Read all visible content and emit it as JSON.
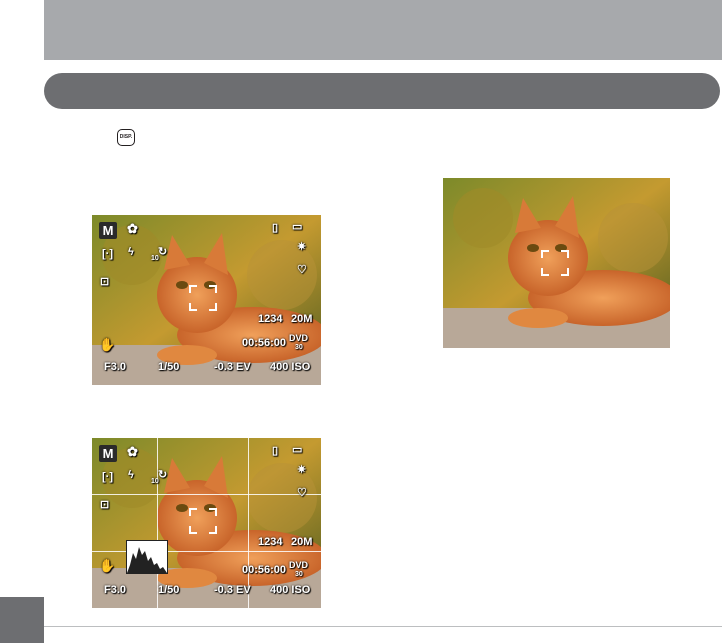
{
  "header": {
    "section_title": ""
  },
  "disp_button": {
    "label": "DISP."
  },
  "osd": {
    "mode": "M",
    "aperture": "F3.0",
    "shutter": "1/50",
    "ev": "-0.3 EV",
    "iso": "400 ISO",
    "shots": "1234",
    "megapixels": "20M",
    "record_time": "00:56:00",
    "video_format": "DVD",
    "video_fps": "30",
    "timer": "10"
  },
  "icons": [
    "macro-flower-icon",
    "flash-slow-sync-icon",
    "self-timer-icon",
    "metering-icon",
    "focus-mode-icon",
    "stabilizer-icon",
    "memory-card-icon",
    "battery-icon",
    "white-balance-icon",
    "vibrance-icon"
  ],
  "colors": {
    "top_bar": "#a7a9ac",
    "section_bar": "#6d6e71"
  }
}
